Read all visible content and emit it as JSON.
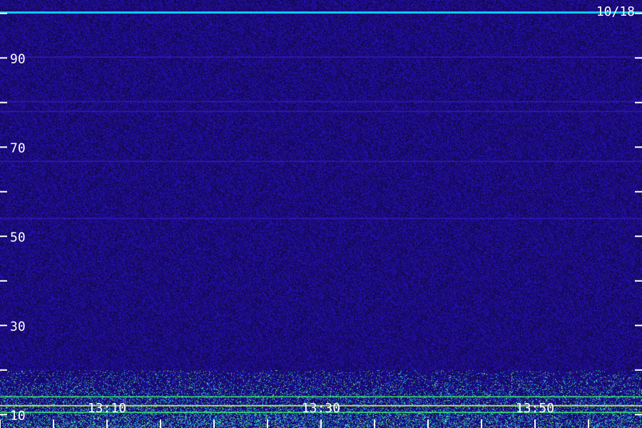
{
  "chart_data": {
    "type": "heatmap",
    "date_label": "10/18",
    "colors": {
      "background_base": "#0c0838",
      "noise_low": "#1a0a60",
      "noise_high": "#3a1ed0",
      "cyan": "#00d8ff",
      "green": "#40ff70",
      "yellow_green": "#c8ff40",
      "tick": "#ffffff"
    },
    "y_axis": {
      "range": [
        7,
        103
      ],
      "tick_values": [
        10,
        20,
        30,
        40,
        50,
        60,
        70,
        80,
        90,
        100
      ],
      "tick_labels": [
        {
          "value": 10,
          "label": "10"
        },
        {
          "value": 30,
          "label": "30"
        },
        {
          "value": 50,
          "label": "50"
        },
        {
          "value": 70,
          "label": "70"
        },
        {
          "value": 90,
          "label": "90"
        }
      ]
    },
    "x_axis": {
      "range": [
        "13:00",
        "14:00"
      ],
      "tick_times": [
        "13:00",
        "13:05",
        "13:10",
        "13:15",
        "13:20",
        "13:25",
        "13:30",
        "13:35",
        "13:40",
        "13:45",
        "13:50",
        "13:55"
      ],
      "tick_labels": [
        {
          "time": "13:10",
          "label": "13:10"
        },
        {
          "time": "13:30",
          "label": "13:30"
        },
        {
          "time": "13:50",
          "label": "13:50"
        }
      ]
    },
    "bands": [
      {
        "value": 100.2,
        "intensity": "strong-cyan"
      },
      {
        "value": 90.2,
        "intensity": "faint"
      },
      {
        "value": 80.2,
        "intensity": "faint"
      },
      {
        "value": 78.0,
        "intensity": "faint"
      },
      {
        "value": 66.8,
        "intensity": "faint"
      },
      {
        "value": 54.0,
        "intensity": "faint"
      },
      {
        "value": 14.0,
        "intensity": "green"
      },
      {
        "value": 12.0,
        "intensity": "yellow-green"
      },
      {
        "value": 10.5,
        "intensity": "green"
      }
    ]
  }
}
